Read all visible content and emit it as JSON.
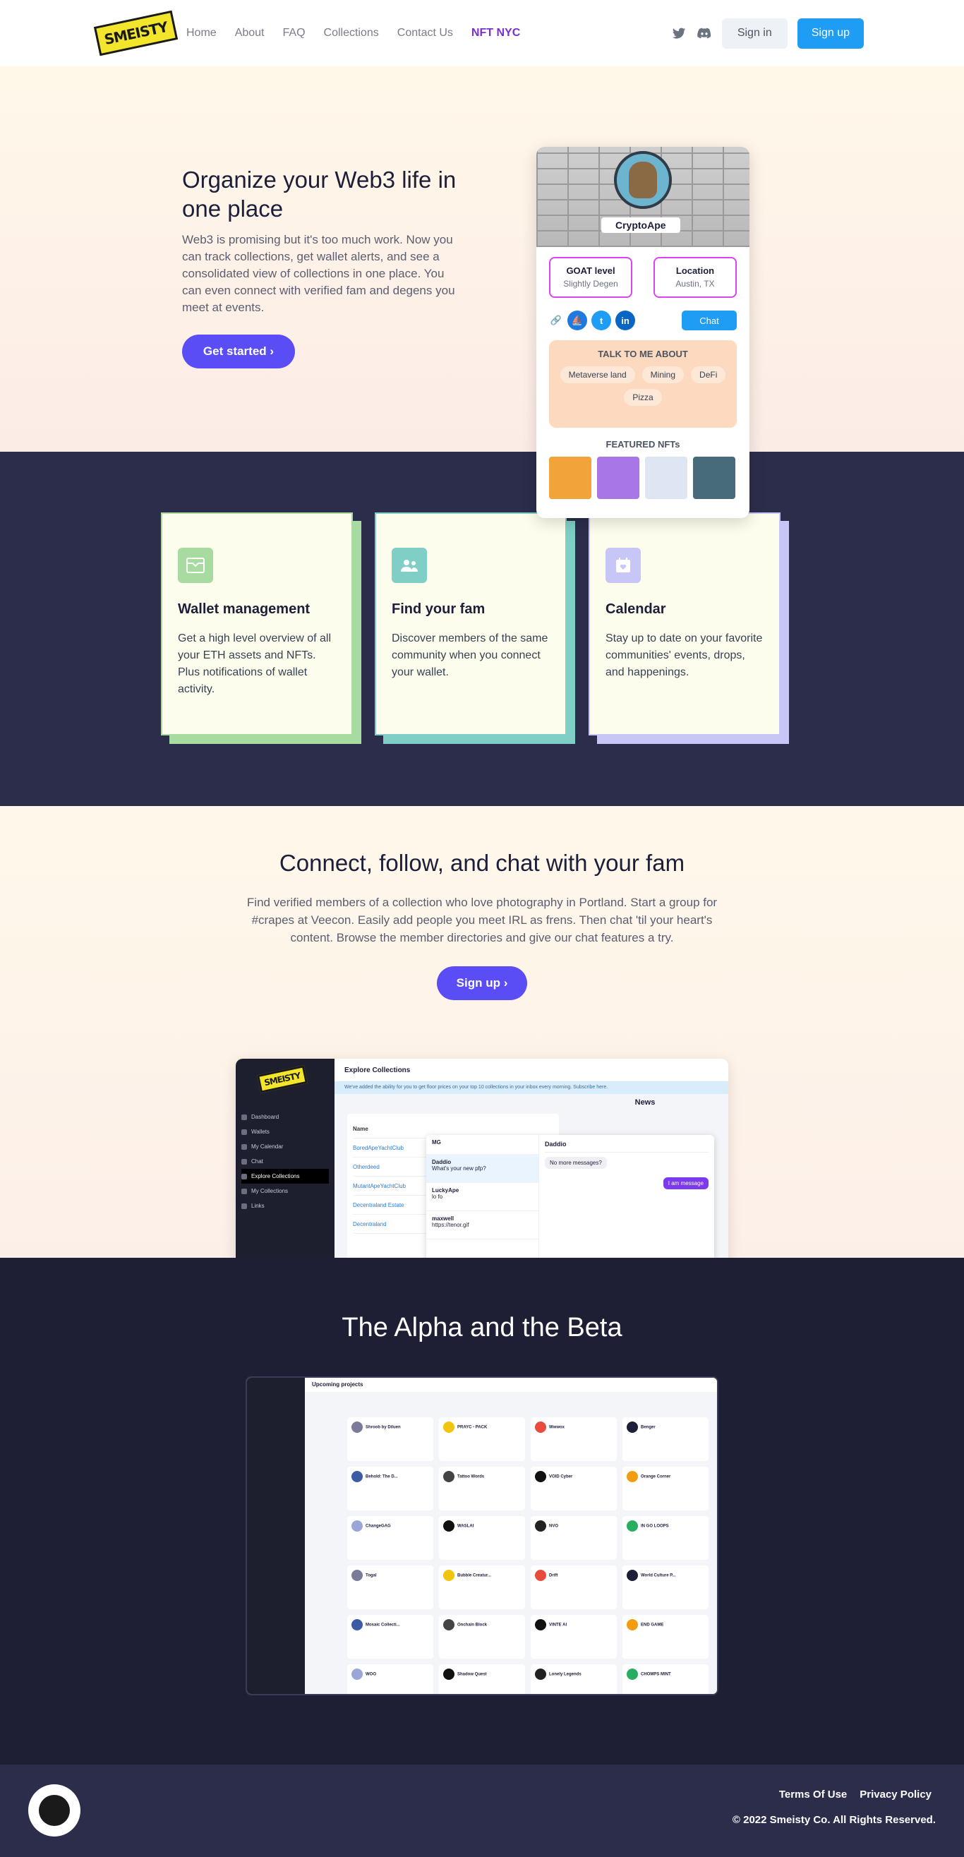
{
  "nav": {
    "logo_text": "SMEISTY",
    "links": [
      "Home",
      "About",
      "FAQ",
      "Collections",
      "Contact Us",
      "NFT NYC"
    ],
    "signin": "Sign in",
    "signup": "Sign up"
  },
  "hero": {
    "title": "Organize your Web3 life in one place",
    "body": "Web3 is promising but it's too much work. Now you can track collections, get wallet alerts, and see a consolidated view of collections in one place. You can even connect with verified fam and degens you meet at events.",
    "cta": "Get started"
  },
  "profile": {
    "name": "CryptoApe",
    "goat_label": "GOAT level",
    "goat_value": "Slightly Degen",
    "location_label": "Location",
    "location_value": "Austin, TX",
    "chat": "Chat",
    "talk_title": "TALK TO ME ABOUT",
    "topics": [
      "Metaverse land",
      "Mining",
      "DeFi",
      "Pizza"
    ],
    "featured_title": "FEATURED NFTs"
  },
  "features": [
    {
      "title": "Wallet management",
      "body": "Get a high level overview of all your ETH assets and NFTs. Plus notifications of wallet activity.",
      "color": "#a8dba0"
    },
    {
      "title": "Find your fam",
      "body": "Discover members of the same community when you connect your wallet.",
      "color": "#7fcfc6"
    },
    {
      "title": "Calendar",
      "body": "Stay up to date on your favorite communities' events, drops, and happenings.",
      "color": "#c7c6f7"
    }
  ],
  "connect": {
    "title": "Connect, follow, and chat with your fam",
    "body": "Find verified members of a collection who love photography in Portland. Start a group for #crapes at Veecon. Easily add people you meet IRL as frens. Then chat 'til your heart's content. Browse the member directories and give our chat features a try.",
    "cta": "Sign up"
  },
  "shot": {
    "title": "Explore Collections",
    "banner": "We've added the ability for you to get floor prices on your top 10 collections in your inbox every morning. Subscribe here.",
    "sidebar": [
      "Dashboard",
      "Wallets",
      "My Calendar",
      "Chat",
      "Explore Collections",
      "My Collections",
      "Links"
    ],
    "table_header": "Name",
    "rows": [
      "BoredApeYachtClub",
      "Otherdeed",
      "MutantApeYachtClub",
      "Decentraland Estate",
      "Decentraland"
    ],
    "chats": [
      {
        "name": "Daddio",
        "msg": "What's your new pfp?"
      },
      {
        "name": "LuckyApe",
        "msg": "lo fo"
      },
      {
        "name": "maxwell",
        "msg": "https://tenor.gif"
      }
    ],
    "chat_with": "Daddio",
    "msg1": "No more messages?",
    "msg2": "I am message",
    "list_header": "MG",
    "news": "News"
  },
  "alpha": {
    "title": "The Alpha and the Beta",
    "shot_title": "Upcoming projects",
    "projects": [
      "Shroob by Diluen",
      "PRAYC - PACK",
      "Wwwox",
      "Benger",
      "Behold: The D...",
      "Tattoo Words",
      "VOID Cyber",
      "Orange Corner",
      "ChangeGAG",
      "WASLAI",
      "NVO",
      "IN GO LOOPS",
      "Togal",
      "Bubble Creatur...",
      "Drift",
      "World Culture P...",
      "Mosaic Collecti...",
      "Onchain Block",
      "VINTE AI",
      "END GAME",
      "WOO",
      "Shadow Quest",
      "Lonely Legends",
      "CHOMPS MINT"
    ]
  },
  "footer": {
    "terms": "Terms Of Use",
    "privacy": "Privacy Policy",
    "copyright": "© 2022 Smeisty Co. All Rights Reserved."
  }
}
